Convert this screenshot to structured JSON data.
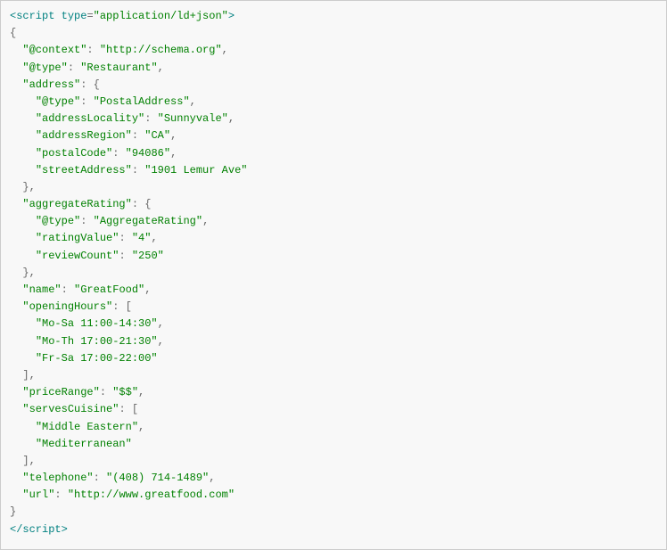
{
  "code": {
    "lines": [
      {
        "parts": [
          {
            "cls": "tag",
            "t": "<script"
          },
          {
            "cls": "plain",
            "t": " "
          },
          {
            "cls": "attr-name",
            "t": "type"
          },
          {
            "cls": "punct",
            "t": "="
          },
          {
            "cls": "attr-val",
            "t": "\"application/ld+json\""
          },
          {
            "cls": "tag",
            "t": ">"
          }
        ]
      },
      {
        "parts": [
          {
            "cls": "brace",
            "t": "{"
          }
        ]
      },
      {
        "parts": [
          {
            "cls": "plain",
            "t": "  "
          },
          {
            "cls": "key",
            "t": "\"@context\""
          },
          {
            "cls": "punct",
            "t": ": "
          },
          {
            "cls": "str",
            "t": "\"http://schema.org\""
          },
          {
            "cls": "punct",
            "t": ","
          }
        ]
      },
      {
        "parts": [
          {
            "cls": "plain",
            "t": "  "
          },
          {
            "cls": "key",
            "t": "\"@type\""
          },
          {
            "cls": "punct",
            "t": ": "
          },
          {
            "cls": "str",
            "t": "\"Restaurant\""
          },
          {
            "cls": "punct",
            "t": ","
          }
        ]
      },
      {
        "parts": [
          {
            "cls": "plain",
            "t": "  "
          },
          {
            "cls": "key",
            "t": "\"address\""
          },
          {
            "cls": "punct",
            "t": ": "
          },
          {
            "cls": "brace",
            "t": "{"
          }
        ]
      },
      {
        "parts": [
          {
            "cls": "plain",
            "t": "    "
          },
          {
            "cls": "key",
            "t": "\"@type\""
          },
          {
            "cls": "punct",
            "t": ": "
          },
          {
            "cls": "str",
            "t": "\"PostalAddress\""
          },
          {
            "cls": "punct",
            "t": ","
          }
        ]
      },
      {
        "parts": [
          {
            "cls": "plain",
            "t": "    "
          },
          {
            "cls": "key",
            "t": "\"addressLocality\""
          },
          {
            "cls": "punct",
            "t": ": "
          },
          {
            "cls": "str",
            "t": "\"Sunnyvale\""
          },
          {
            "cls": "punct",
            "t": ","
          }
        ]
      },
      {
        "parts": [
          {
            "cls": "plain",
            "t": "    "
          },
          {
            "cls": "key",
            "t": "\"addressRegion\""
          },
          {
            "cls": "punct",
            "t": ": "
          },
          {
            "cls": "str",
            "t": "\"CA\""
          },
          {
            "cls": "punct",
            "t": ","
          }
        ]
      },
      {
        "parts": [
          {
            "cls": "plain",
            "t": "    "
          },
          {
            "cls": "key",
            "t": "\"postalCode\""
          },
          {
            "cls": "punct",
            "t": ": "
          },
          {
            "cls": "str",
            "t": "\"94086\""
          },
          {
            "cls": "punct",
            "t": ","
          }
        ]
      },
      {
        "parts": [
          {
            "cls": "plain",
            "t": "    "
          },
          {
            "cls": "key",
            "t": "\"streetAddress\""
          },
          {
            "cls": "punct",
            "t": ": "
          },
          {
            "cls": "str",
            "t": "\"1901 Lemur Ave\""
          }
        ]
      },
      {
        "parts": [
          {
            "cls": "plain",
            "t": "  "
          },
          {
            "cls": "brace",
            "t": "}"
          },
          {
            "cls": "punct",
            "t": ","
          }
        ]
      },
      {
        "parts": [
          {
            "cls": "plain",
            "t": "  "
          },
          {
            "cls": "key",
            "t": "\"aggregateRating\""
          },
          {
            "cls": "punct",
            "t": ": "
          },
          {
            "cls": "brace",
            "t": "{"
          }
        ]
      },
      {
        "parts": [
          {
            "cls": "plain",
            "t": "    "
          },
          {
            "cls": "key",
            "t": "\"@type\""
          },
          {
            "cls": "punct",
            "t": ": "
          },
          {
            "cls": "str",
            "t": "\"AggregateRating\""
          },
          {
            "cls": "punct",
            "t": ","
          }
        ]
      },
      {
        "parts": [
          {
            "cls": "plain",
            "t": "    "
          },
          {
            "cls": "key",
            "t": "\"ratingValue\""
          },
          {
            "cls": "punct",
            "t": ": "
          },
          {
            "cls": "str",
            "t": "\"4\""
          },
          {
            "cls": "punct",
            "t": ","
          }
        ]
      },
      {
        "parts": [
          {
            "cls": "plain",
            "t": "    "
          },
          {
            "cls": "key",
            "t": "\"reviewCount\""
          },
          {
            "cls": "punct",
            "t": ": "
          },
          {
            "cls": "str",
            "t": "\"250\""
          }
        ]
      },
      {
        "parts": [
          {
            "cls": "plain",
            "t": "  "
          },
          {
            "cls": "brace",
            "t": "}"
          },
          {
            "cls": "punct",
            "t": ","
          }
        ]
      },
      {
        "parts": [
          {
            "cls": "plain",
            "t": "  "
          },
          {
            "cls": "key",
            "t": "\"name\""
          },
          {
            "cls": "punct",
            "t": ": "
          },
          {
            "cls": "str",
            "t": "\"GreatFood\""
          },
          {
            "cls": "punct",
            "t": ","
          }
        ]
      },
      {
        "parts": [
          {
            "cls": "plain",
            "t": "  "
          },
          {
            "cls": "key",
            "t": "\"openingHours\""
          },
          {
            "cls": "punct",
            "t": ": "
          },
          {
            "cls": "brace",
            "t": "["
          }
        ]
      },
      {
        "parts": [
          {
            "cls": "plain",
            "t": "    "
          },
          {
            "cls": "str",
            "t": "\"Mo-Sa 11:00-14:30\""
          },
          {
            "cls": "punct",
            "t": ","
          }
        ]
      },
      {
        "parts": [
          {
            "cls": "plain",
            "t": "    "
          },
          {
            "cls": "str",
            "t": "\"Mo-Th 17:00-21:30\""
          },
          {
            "cls": "punct",
            "t": ","
          }
        ]
      },
      {
        "parts": [
          {
            "cls": "plain",
            "t": "    "
          },
          {
            "cls": "str",
            "t": "\"Fr-Sa 17:00-22:00\""
          }
        ]
      },
      {
        "parts": [
          {
            "cls": "plain",
            "t": "  "
          },
          {
            "cls": "brace",
            "t": "]"
          },
          {
            "cls": "punct",
            "t": ","
          }
        ]
      },
      {
        "parts": [
          {
            "cls": "plain",
            "t": "  "
          },
          {
            "cls": "key",
            "t": "\"priceRange\""
          },
          {
            "cls": "punct",
            "t": ": "
          },
          {
            "cls": "str",
            "t": "\"$$\""
          },
          {
            "cls": "punct",
            "t": ","
          }
        ]
      },
      {
        "parts": [
          {
            "cls": "plain",
            "t": "  "
          },
          {
            "cls": "key",
            "t": "\"servesCuisine\""
          },
          {
            "cls": "punct",
            "t": ": "
          },
          {
            "cls": "brace",
            "t": "["
          }
        ]
      },
      {
        "parts": [
          {
            "cls": "plain",
            "t": "    "
          },
          {
            "cls": "str",
            "t": "\"Middle Eastern\""
          },
          {
            "cls": "punct",
            "t": ","
          }
        ]
      },
      {
        "parts": [
          {
            "cls": "plain",
            "t": "    "
          },
          {
            "cls": "str",
            "t": "\"Mediterranean\""
          }
        ]
      },
      {
        "parts": [
          {
            "cls": "plain",
            "t": "  "
          },
          {
            "cls": "brace",
            "t": "]"
          },
          {
            "cls": "punct",
            "t": ","
          }
        ]
      },
      {
        "parts": [
          {
            "cls": "plain",
            "t": "  "
          },
          {
            "cls": "key",
            "t": "\"telephone\""
          },
          {
            "cls": "punct",
            "t": ": "
          },
          {
            "cls": "str",
            "t": "\"(408) 714-1489\""
          },
          {
            "cls": "punct",
            "t": ","
          }
        ]
      },
      {
        "parts": [
          {
            "cls": "plain",
            "t": "  "
          },
          {
            "cls": "key",
            "t": "\"url\""
          },
          {
            "cls": "punct",
            "t": ": "
          },
          {
            "cls": "str",
            "t": "\"http://www.greatfood.com\""
          }
        ]
      },
      {
        "parts": [
          {
            "cls": "brace",
            "t": "}"
          }
        ]
      },
      {
        "parts": [
          {
            "cls": "tag",
            "t": "</scr"
          },
          {
            "cls": "tag",
            "t": "ipt>"
          }
        ]
      }
    ]
  }
}
